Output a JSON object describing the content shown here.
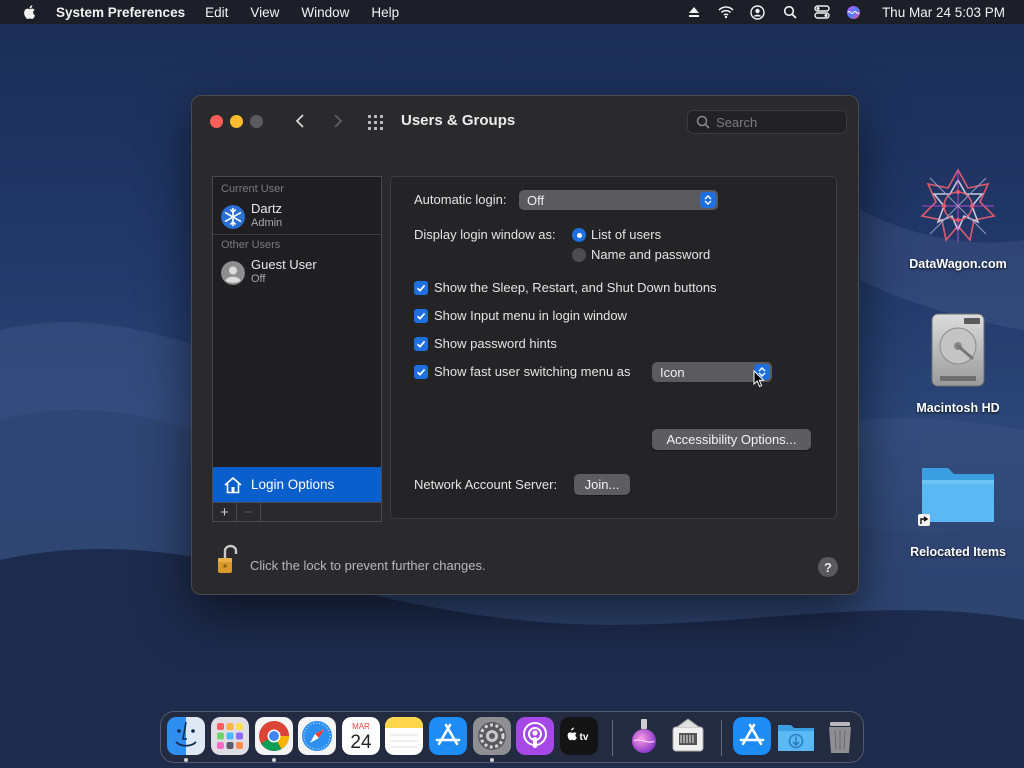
{
  "menubar": {
    "app_name": "System Preferences",
    "menus": [
      "Edit",
      "View",
      "Window",
      "Help"
    ],
    "clock": "Thu Mar 24  5:03 PM"
  },
  "window": {
    "title": "Users & Groups",
    "search_placeholder": "Search"
  },
  "sidebar": {
    "current_user_label": "Current User",
    "current_user": {
      "name": "Dartz",
      "role": "Admin"
    },
    "other_users_label": "Other Users",
    "other_users": [
      {
        "name": "Guest User",
        "status": "Off"
      }
    ],
    "login_options_label": "Login Options",
    "add_label": "+",
    "remove_label": "−"
  },
  "panel": {
    "automatic_login_label": "Automatic login:",
    "automatic_login_value": "Off",
    "display_login_label": "Display login window as:",
    "display_options": [
      {
        "label": "List of users",
        "selected": true
      },
      {
        "label": "Name and password",
        "selected": false
      }
    ],
    "checkboxes": [
      {
        "label": "Show the Sleep, Restart, and Shut Down buttons",
        "checked": true
      },
      {
        "label": "Show Input menu in login window",
        "checked": true
      },
      {
        "label": "Show password hints",
        "checked": true
      },
      {
        "label": "Show fast user switching menu as",
        "checked": true
      }
    ],
    "fast_switch_value": "Icon",
    "accessibility_button": "Accessibility Options...",
    "network_server_label": "Network Account Server:",
    "join_button": "Join..."
  },
  "lock_text": "Click the lock to prevent further changes.",
  "help_label": "?",
  "desktop_icons": [
    {
      "label": "DataWagon.com",
      "icon": "datawagon-icon"
    },
    {
      "label": "Macintosh HD",
      "icon": "hard-drive-icon"
    },
    {
      "label": "Relocated Items",
      "icon": "folder-alias-icon"
    }
  ],
  "dock": {
    "apps": [
      "finder",
      "launchpad",
      "chrome",
      "safari",
      "calendar",
      "notes",
      "app-store",
      "system-preferences",
      "podcasts",
      "apple-tv",
      "sidebar-divider",
      "app-one",
      "app-two",
      "sidebar-divider",
      "app-store-folder",
      "downloads",
      "trash"
    ],
    "calendar_month": "MAR",
    "calendar_day": "24",
    "tv_label": "tv"
  },
  "colors": {
    "accent": "#1f6fe0",
    "selection": "#0a5fcc",
    "window_bg": "#2a2a2c"
  }
}
